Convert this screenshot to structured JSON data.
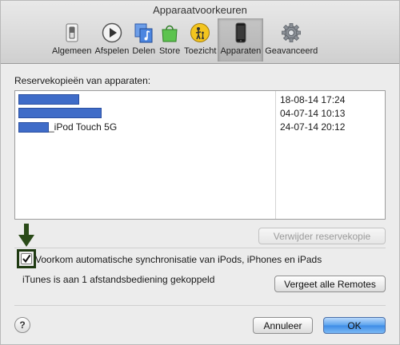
{
  "window": {
    "title": "Apparaatvoorkeuren"
  },
  "toolbar": {
    "items": [
      {
        "label": "Algemeen",
        "icon": "switch-icon"
      },
      {
        "label": "Afspelen",
        "icon": "play-icon"
      },
      {
        "label": "Delen",
        "icon": "music-share-icon"
      },
      {
        "label": "Store",
        "icon": "shopping-bag-icon"
      },
      {
        "label": "Toezicht",
        "icon": "parental-icon"
      },
      {
        "label": "Apparaten",
        "icon": "device-icon",
        "selected": true
      },
      {
        "label": "Geavanceerd",
        "icon": "gear-icon"
      }
    ]
  },
  "backups": {
    "label": "Reservekopieën van apparaten:",
    "rows": [
      {
        "name": "",
        "date": "18-08-14 17:24"
      },
      {
        "name": "",
        "date": "04-07-14 10:13"
      },
      {
        "name": "_iPod Touch 5G",
        "date": "24-07-14 20:12"
      }
    ],
    "delete_button": "Verwijder reservekopie"
  },
  "sync": {
    "checkbox_label": "Voorkom automatische synchronisatie van iPods, iPhones en iPads",
    "checked": true
  },
  "remotes": {
    "status": "iTunes is aan 1 afstandsbediening gekoppeld",
    "forget_button": "Vergeet alle Remotes"
  },
  "footer": {
    "help": "?",
    "cancel": "Annuleer",
    "ok": "OK"
  },
  "colors": {
    "redaction": "#3f6cc8",
    "annotation": "#2a4a18",
    "default_button": "#3d8be6"
  }
}
